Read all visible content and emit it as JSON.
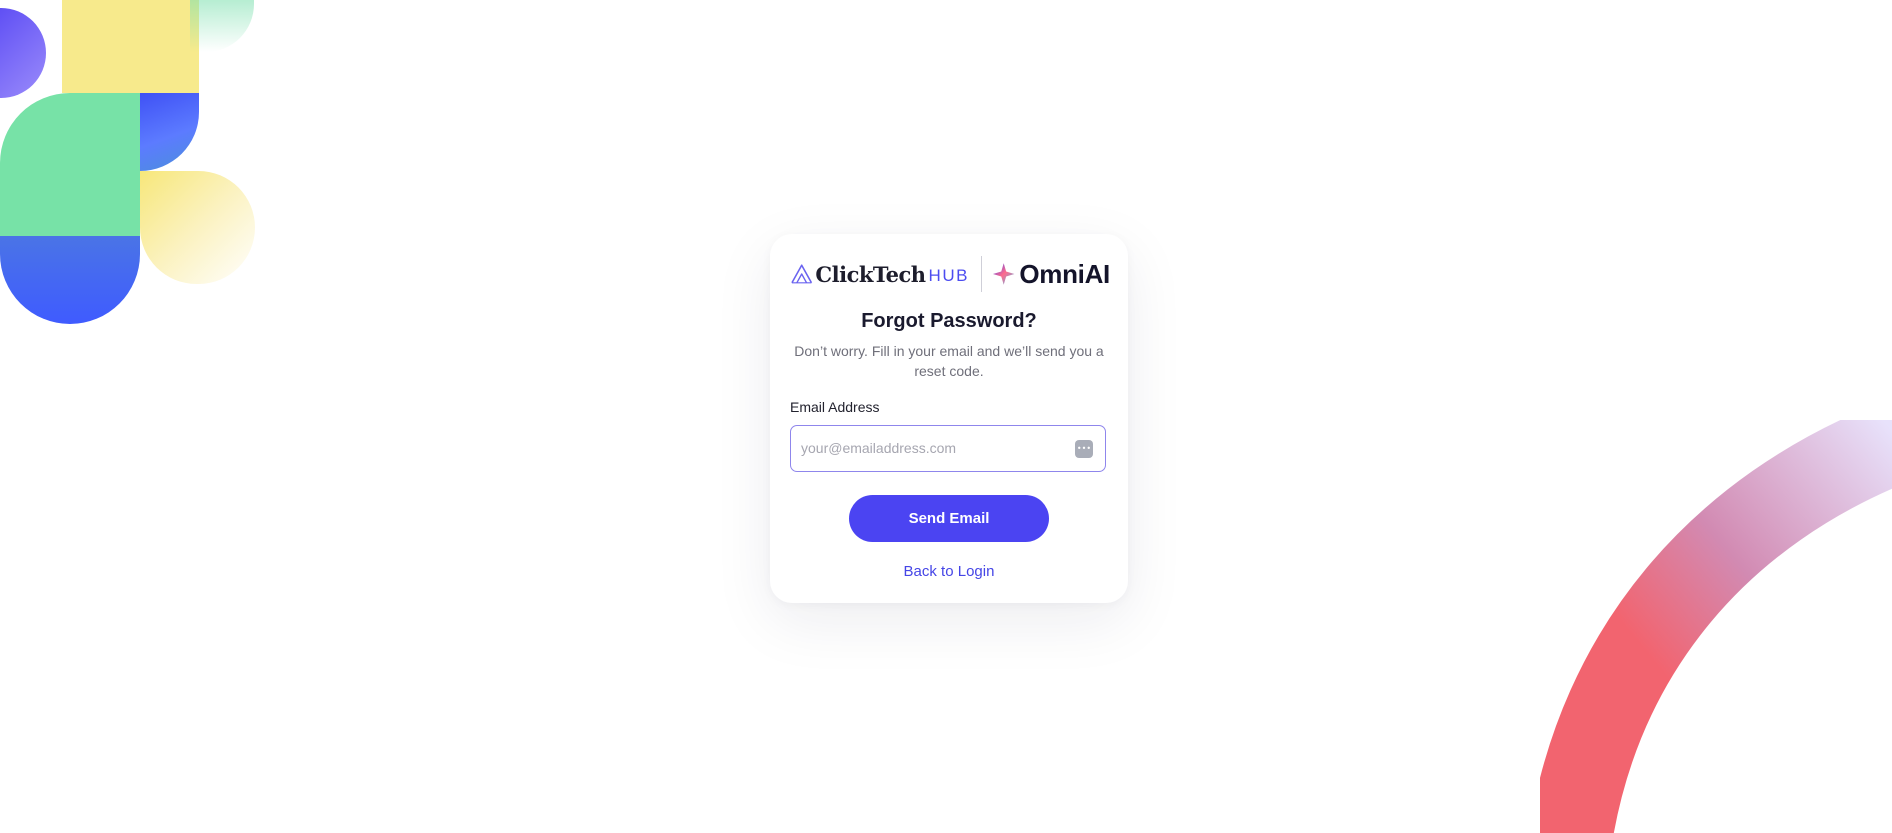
{
  "logos": {
    "brand_primary": "ClickTech",
    "brand_primary_suffix": "HUB",
    "brand_secondary": "OmniAI"
  },
  "form": {
    "title": "Forgot Password?",
    "subtitle": "Don’t worry. Fill in your email and we’ll send you a reset code.",
    "email_label": "Email Address",
    "email_placeholder": "your@emailaddress.com",
    "email_value": "",
    "submit_label": "Send Email",
    "back_link_label": "Back to Login"
  },
  "colors": {
    "accent": "#4b44f2",
    "link": "#4545e6",
    "input_border": "#8f86ec",
    "title_text": "#1a1a2e",
    "body_text": "#6f6f7a"
  },
  "icons": {
    "brand_primary_icon": "clicktech-a-logo-icon",
    "brand_secondary_icon": "omniai-star-logo-icon",
    "input_autofill_icon": "password-manager-autofill-icon"
  }
}
